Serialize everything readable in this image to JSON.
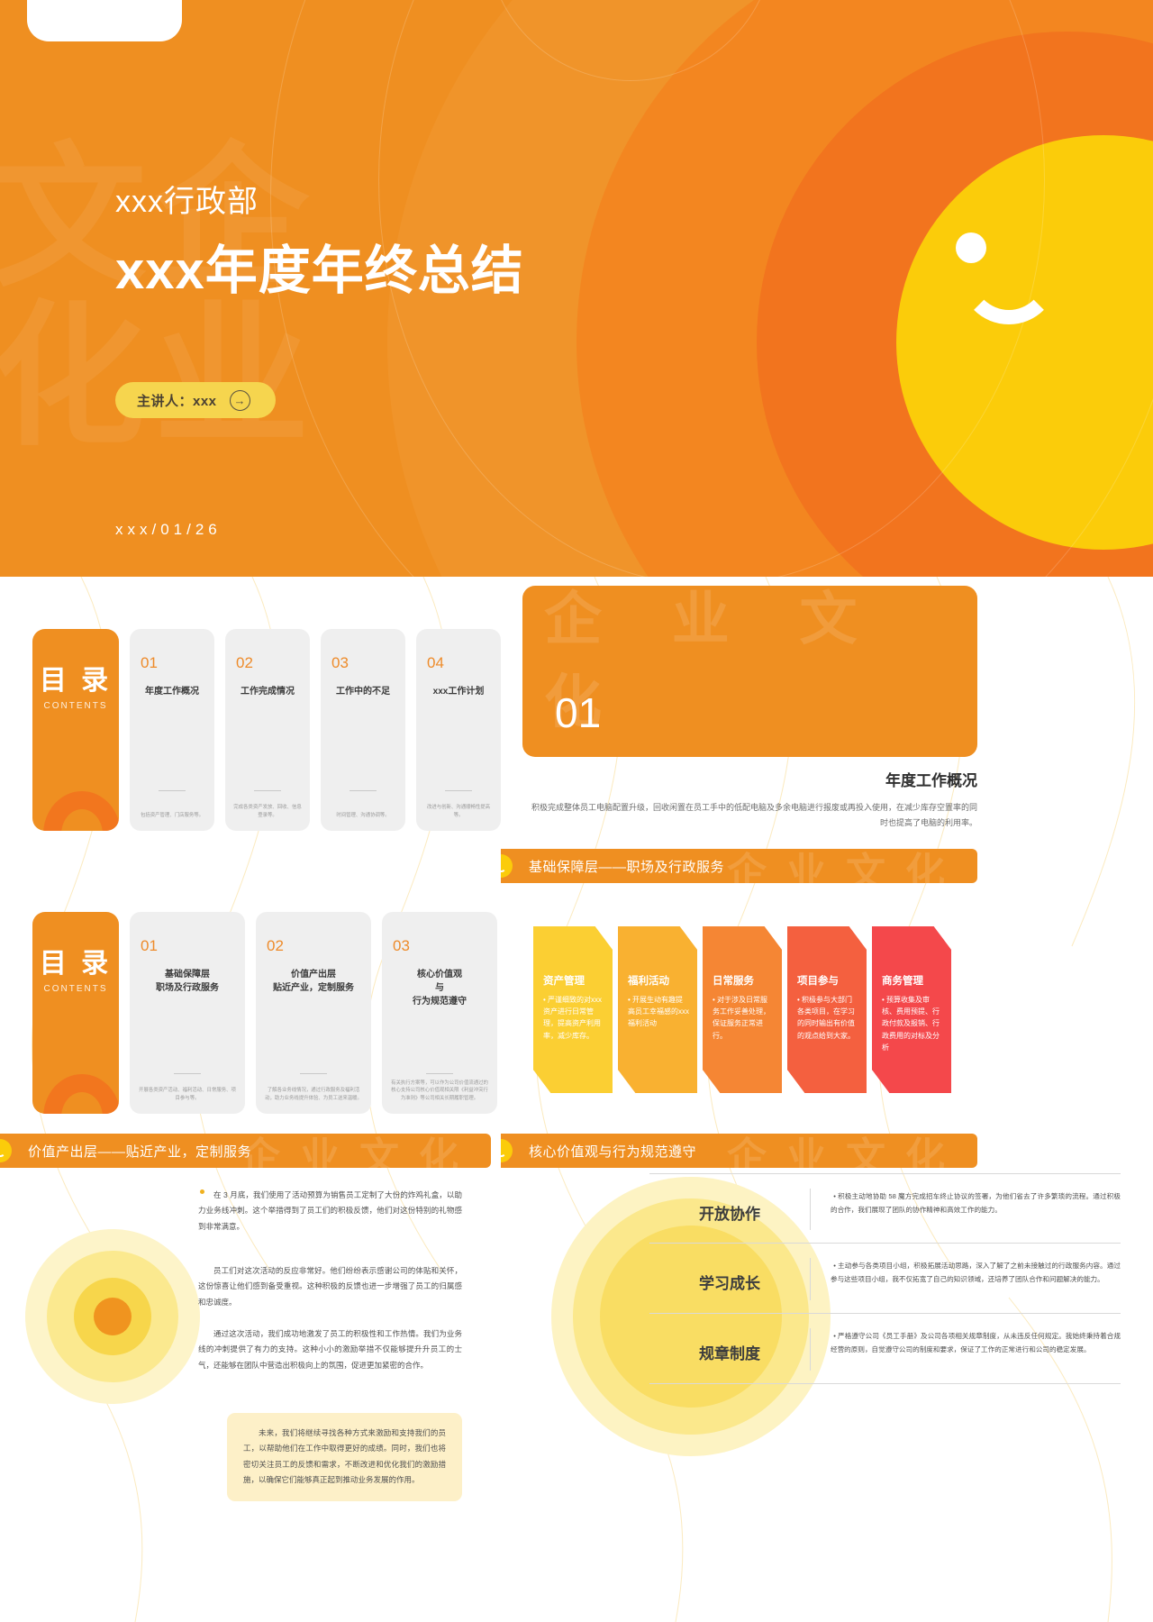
{
  "hero": {
    "department": "xxx行政部",
    "title": "xxx年度年终总结",
    "speaker_label": "主讲人：xxx",
    "arrow_icon": "→",
    "date": "xxx/01/26",
    "watermark": "企业文化",
    "colors": {
      "base": "#ef8f21",
      "ring2": "#f38620",
      "ring3": "#f2741e",
      "face": "#fbcc0a"
    }
  },
  "toc1": {
    "badge_zh": "目 录",
    "badge_en": "CONTENTS",
    "items": [
      {
        "num": "01",
        "title": "年度工作概况",
        "desc": "包括资产管理、门店服务等。"
      },
      {
        "num": "02",
        "title": "工作完成情况",
        "desc": "完成各类资产发放、回收、信息登录等。"
      },
      {
        "num": "03",
        "title": "工作中的不足",
        "desc": "时间管理、沟通协调等。"
      },
      {
        "num": "04",
        "title": "xxx工作计划",
        "desc": "改进与创新、沟通顺畅性提高等。"
      }
    ]
  },
  "toc2": {
    "badge_zh": "目 录",
    "badge_en": "CONTENTS",
    "items": [
      {
        "num": "01",
        "title": "基础保障层\n职场及行政服务",
        "desc": "开展各类资产活动、福利活动、日常服务、项目参与等。"
      },
      {
        "num": "02",
        "title": "价值产出层\n贴近产业，定制服务",
        "desc": "了解各业务线情况，通过行政服务及福利活动，助力业务线提升体验、为员工送来温暖。"
      },
      {
        "num": "03",
        "title": "核心价值观\n与\n行为规范遵守",
        "desc": "有关执行方案等，可以作为公司价值流通过的核心支持公司核心价值观相关限《利益冲突行为准则》等公司相关长期履职管理。"
      }
    ]
  },
  "section01": {
    "number": "01",
    "watermark": "企 业 文 化",
    "title": "年度工作概况",
    "desc": "积极完成整体员工电脑配置升级，回收闲置在员工手中的低配电脑及多余电脑进行报废或再投入使用，在减少库存空置率的同时也提高了电脑的利用率。"
  },
  "bars": {
    "a": {
      "label": "基础保障层——职场及行政服务",
      "watermark": "企业文化"
    },
    "b": {
      "label": "价值产出层——贴近产业，定制服务",
      "watermark": "企业文化"
    },
    "c": {
      "label": "核心价值观与行为规范遵守",
      "watermark": "企业文化"
    }
  },
  "chevrons": [
    {
      "title": "资产管理",
      "body": "严谨细致的对xxx资产进行日常管理，提高资产利用率，减少库存。",
      "color": "#fbcf33"
    },
    {
      "title": "福利活动",
      "body": "开展生动有趣提高员工幸福感的xxx福利活动",
      "color": "#f9b131"
    },
    {
      "title": "日常服务",
      "body": "对于涉及日常服务工作妥善处理，保证服务正常进行。",
      "color": "#f58634"
    },
    {
      "title": "项目参与",
      "body": "积极参与大部门各类项目，在学习的同时输出有价值的观点给到大家。",
      "color": "#f4603f"
    },
    {
      "title": "商务管理",
      "body": "预算收集及审核、费用预提、行政付款及报销、行政费用的对标及分析",
      "color": "#f4484b"
    }
  ],
  "value_panel": {
    "p1": "在 3 月底，我们使用了活动预算为销售员工定制了大份的炸鸡礼盒，以助力业务线冲刺。这个举措得到了员工们的积极反馈，他们对这份特别的礼物感到非常满意。",
    "p2": "员工们对这次活动的反应非常好。他们纷纷表示感谢公司的体贴和关怀，这份惊喜让他们感到备受重视。这种积极的反馈也进一步增强了员工的归属感和忠诚度。",
    "p3": "通过这次活动，我们成功地激发了员工的积极性和工作热情。我们为业务线的冲刺提供了有力的支持。这种小小的激励举措不仅能够提升升员工的士气，还能够在团队中营造出积极向上的氛围，促进更加紧密的合作。",
    "note": "未来，我们将继续寻找各种方式来激励和支持我们的员工，以帮助他们在工作中取得更好的成绩。同时，我们也将密切关注员工的反馈和需求，不断改进和优化我们的激励措施，以确保它们能够真正起到推动业务发展的作用。"
  },
  "core_values": [
    {
      "key": "开放协作",
      "value": "积极主动地协助 58 魔方完成招车终止协议的签署，为他们省去了许多繁琐的流程。通过积极的合作，我们展现了团队的协作精神和高效工作的能力。"
    },
    {
      "key": "学习成长",
      "value": "主动参与各类项目小组，积极拓展活动思路，深入了解了之前未接触过的行政服务内容。通过参与这些项目小组，我不仅拓宽了自己的知识领域，还培养了团队合作和问题解决的能力。"
    },
    {
      "key": "规章制度",
      "value": "严格遵守公司《员工手册》及公司各项相关规章制度，从未违反任何规定。我始终秉持着合规经营的原则，自觉遵守公司的制度和要求，保证了工作的正常进行和公司的稳定发展。"
    }
  ]
}
